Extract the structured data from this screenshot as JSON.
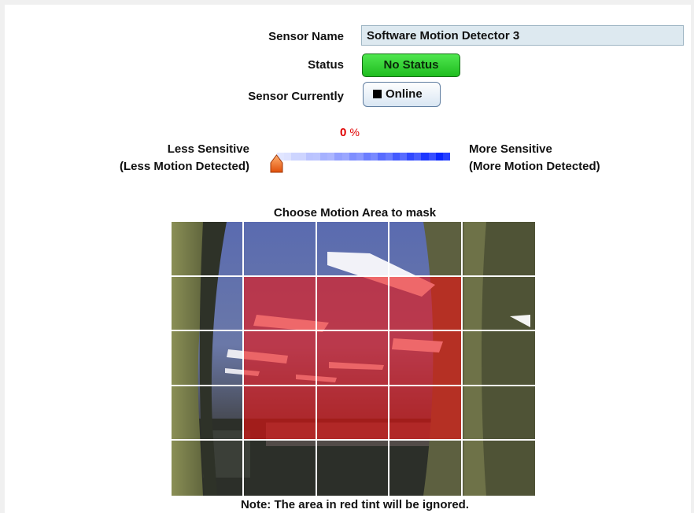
{
  "sensor": {
    "name_label": "Sensor Name",
    "name_value": "Software Motion Detector 3",
    "status_label": "Status",
    "status_value": "No Status",
    "currently_label": "Sensor Currently",
    "currently_value": "Online"
  },
  "sensitivity": {
    "value_percent": 0,
    "value_number": "0",
    "value_unit": "%",
    "left_title": "Less Sensitive",
    "left_sub": "(Less Motion Detected)",
    "right_title": "More Sensitive",
    "right_sub": "(More Motion Detected)"
  },
  "mask": {
    "title": "Choose Motion Area to mask",
    "note": "Note: The area in red tint will be ignored.",
    "rows": 5,
    "cols": 5,
    "masked_cells": [
      [
        0,
        0,
        0,
        0,
        0
      ],
      [
        0,
        1,
        1,
        1,
        0
      ],
      [
        0,
        1,
        1,
        1,
        0
      ],
      [
        0,
        1,
        1,
        1,
        0
      ],
      [
        0,
        0,
        0,
        0,
        0
      ]
    ]
  },
  "colors": {
    "status_green": "#2ed12e",
    "sensitivity_blue": "#0022dd",
    "mask_red": "#eb1414",
    "percent_red": "#e00000"
  }
}
